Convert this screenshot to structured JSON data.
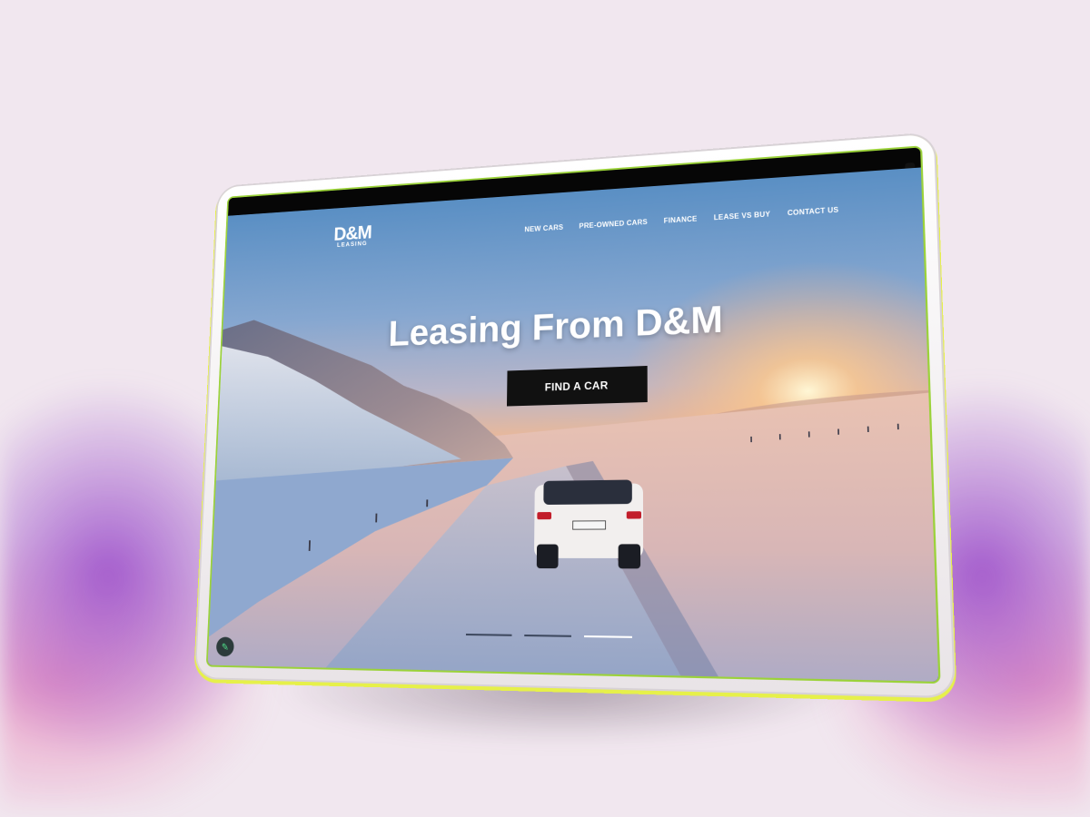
{
  "site": {
    "logo": {
      "mark": "D&M",
      "sub": "LEASING"
    },
    "nav": [
      {
        "label": "NEW CARS"
      },
      {
        "label": "PRE-OWNED CARS"
      },
      {
        "label": "FINANCE"
      },
      {
        "label": "LEASE VS BUY"
      },
      {
        "label": "CONTACT US"
      }
    ],
    "hero": {
      "headline": "Leasing From D&M",
      "cta_label": "FIND A CAR",
      "slides": 3,
      "active_slide": 3
    },
    "edit_icon": "pencil-icon"
  },
  "colors": {
    "background": "#f1e7ef",
    "accent_glow": "#9646c8",
    "bezel_edge": "#e6f04a",
    "screen_edge": "#9bd23a",
    "cta_bg": "#111111"
  }
}
